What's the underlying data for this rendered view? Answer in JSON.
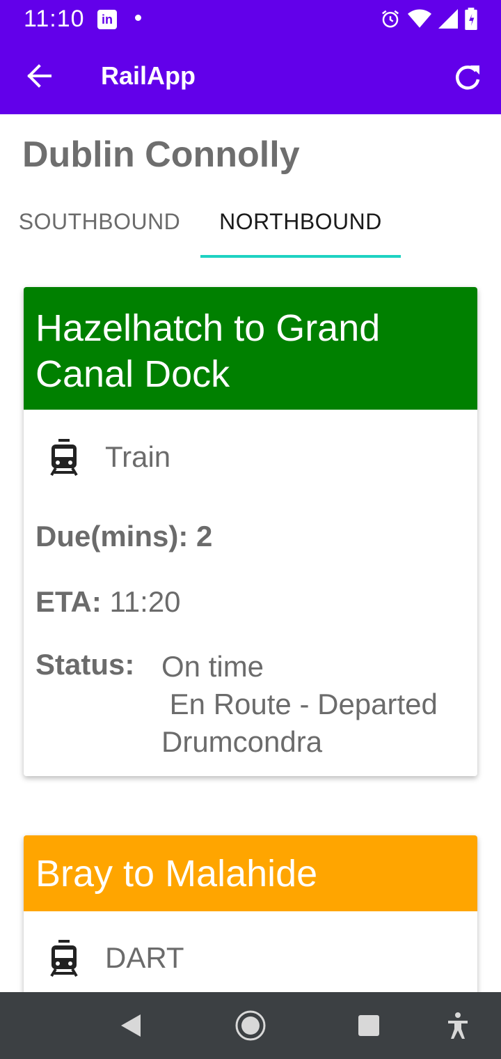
{
  "status_bar": {
    "time": "11:10",
    "linkedin_badge": "in",
    "icons": [
      "linkedin-icon",
      "dot-icon",
      "alarm-icon",
      "wifi-icon",
      "signal-icon",
      "battery-icon"
    ]
  },
  "app_bar": {
    "title": "RailApp",
    "back_icon": "arrow-back-icon",
    "refresh_icon": "refresh-icon",
    "color": "#6200ea"
  },
  "station_name": "Dublin Connolly",
  "tabs": [
    {
      "label": "SOUTHBOUND",
      "selected": false
    },
    {
      "label": "NORTHBOUND",
      "selected": true
    }
  ],
  "tab_indicator_color": "#1ed2c2",
  "trains": [
    {
      "route": "Hazelhatch to Grand Canal Dock",
      "header_color": "#008000",
      "type": "Train",
      "due_label": "Due(mins):",
      "due_value": "2",
      "eta_label": "ETA:",
      "eta_value": "11:20",
      "status_label": "Status:",
      "status_value": "On time\n En Route - Departed\nDrumcondra"
    },
    {
      "route": "Bray to Malahide",
      "header_color": "#ffa500",
      "type": "DART"
    }
  ],
  "nav_bar": {
    "buttons": [
      "back-triangle-icon",
      "home-circle-icon",
      "recents-square-icon",
      "accessibility-icon"
    ]
  }
}
